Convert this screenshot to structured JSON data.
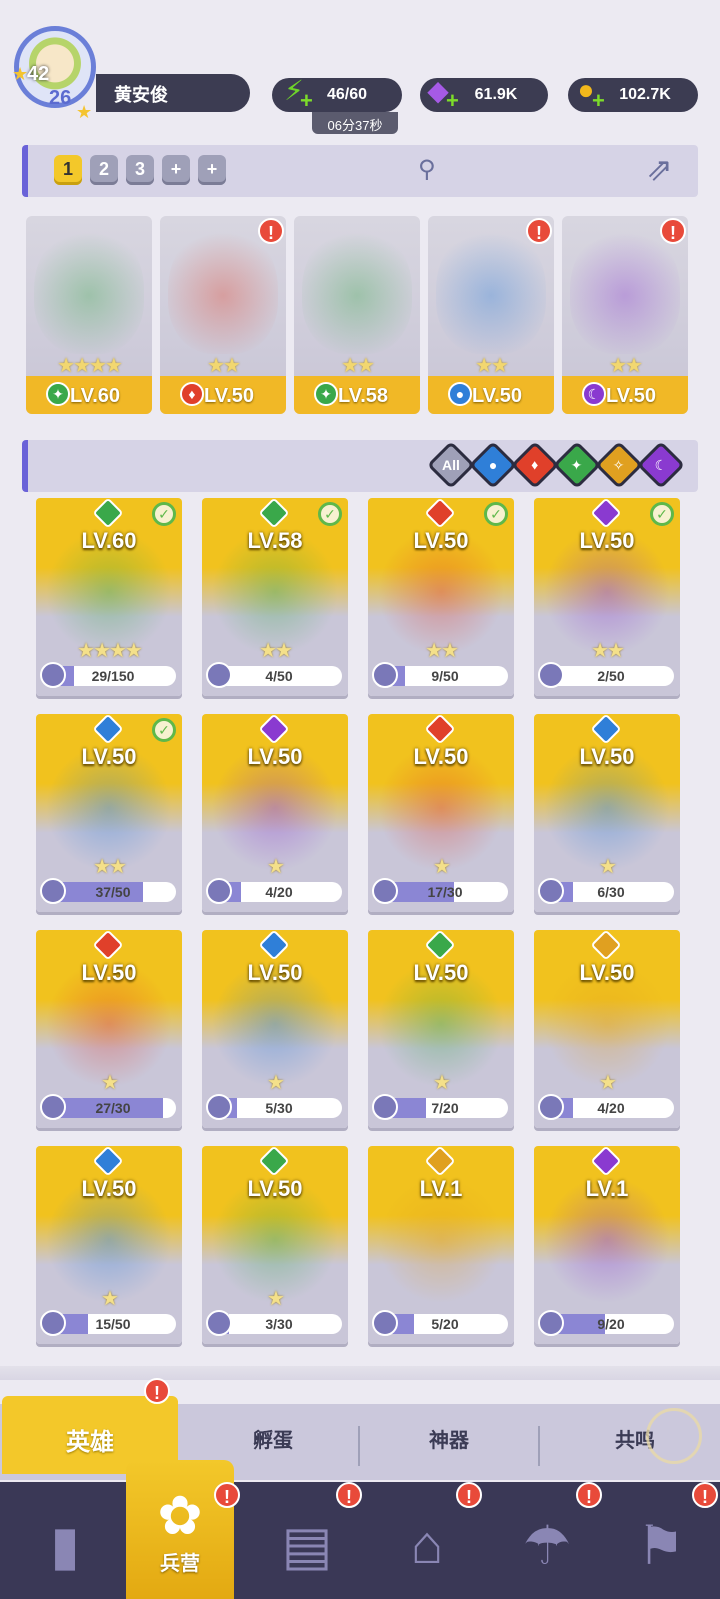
{
  "player": {
    "level": "42",
    "avatar_sub": "26",
    "name": "黄安俊"
  },
  "resources": {
    "energy": "46/60",
    "energy_timer": "06分37秒",
    "gems": "61.9K",
    "coins": "102.7K"
  },
  "team_tabs": [
    "1",
    "2",
    "3",
    "+",
    "+"
  ],
  "active_team": "1",
  "team": [
    {
      "level": "LV.60",
      "stars": "★★★★",
      "element": "earth",
      "alert": false
    },
    {
      "level": "LV.50",
      "stars": "★★",
      "element": "fire",
      "alert": true
    },
    {
      "level": "LV.58",
      "stars": "★★",
      "element": "earth",
      "alert": false
    },
    {
      "level": "LV.50",
      "stars": "★★",
      "element": "water",
      "alert": true
    },
    {
      "level": "LV.50",
      "stars": "★★",
      "element": "dark",
      "alert": true
    }
  ],
  "filters": [
    "All",
    "water",
    "fire",
    "earth",
    "light",
    "dark"
  ],
  "heroes": [
    {
      "level": "LV.60",
      "stars": "★★★★",
      "progress": "29/150",
      "fill": 0.19,
      "element": "earth",
      "in_team": true
    },
    {
      "level": "LV.58",
      "stars": "★★",
      "progress": "4/50",
      "fill": 0.08,
      "element": "earth",
      "in_team": true
    },
    {
      "level": "LV.50",
      "stars": "★★",
      "progress": "9/50",
      "fill": 0.18,
      "element": "fire",
      "in_team": true
    },
    {
      "level": "LV.50",
      "stars": "★★",
      "progress": "2/50",
      "fill": 0.04,
      "element": "dark",
      "in_team": true
    },
    {
      "level": "LV.50",
      "stars": "★★",
      "progress": "37/50",
      "fill": 0.74,
      "element": "water",
      "in_team": true
    },
    {
      "level": "LV.50",
      "stars": "★",
      "progress": "4/20",
      "fill": 0.2,
      "element": "dark",
      "in_team": false
    },
    {
      "level": "LV.50",
      "stars": "★",
      "progress": "17/30",
      "fill": 0.57,
      "element": "fire",
      "in_team": false
    },
    {
      "level": "LV.50",
      "stars": "★",
      "progress": "6/30",
      "fill": 0.2,
      "element": "water",
      "in_team": false
    },
    {
      "level": "LV.50",
      "stars": "★",
      "progress": "27/30",
      "fill": 0.9,
      "element": "fire",
      "in_team": false
    },
    {
      "level": "LV.50",
      "stars": "★",
      "progress": "5/30",
      "fill": 0.17,
      "element": "water",
      "in_team": false
    },
    {
      "level": "LV.50",
      "stars": "★",
      "progress": "7/20",
      "fill": 0.35,
      "element": "earth",
      "in_team": false
    },
    {
      "level": "LV.50",
      "stars": "★",
      "progress": "4/20",
      "fill": 0.2,
      "element": "light",
      "in_team": false
    },
    {
      "level": "LV.50",
      "stars": "★",
      "progress": "15/50",
      "fill": 0.3,
      "element": "water",
      "in_team": false
    },
    {
      "level": "LV.50",
      "stars": "★",
      "progress": "3/30",
      "fill": 0.1,
      "element": "earth",
      "in_team": false
    },
    {
      "level": "LV.1",
      "stars": "",
      "progress": "5/20",
      "fill": 0.25,
      "element": "light",
      "in_team": false
    },
    {
      "level": "LV.1",
      "stars": "",
      "progress": "9/20",
      "fill": 0.45,
      "element": "dark",
      "in_team": false
    }
  ],
  "sub_tabs": [
    "英雄",
    "孵蛋",
    "神器",
    "共鸣"
  ],
  "nav": {
    "active_label": "兵营",
    "items": [
      "cards-icon",
      "barracks-icon",
      "map-book-icon",
      "castle-icon",
      "mushroom-house-icon",
      "banner-icon"
    ]
  },
  "colors": {
    "earth": "#3aa84a",
    "fire": "#e0402a",
    "water": "#2f7fd8",
    "light": "#e0a020",
    "dark": "#8a3ad0",
    "accent": "#f3c82a"
  }
}
